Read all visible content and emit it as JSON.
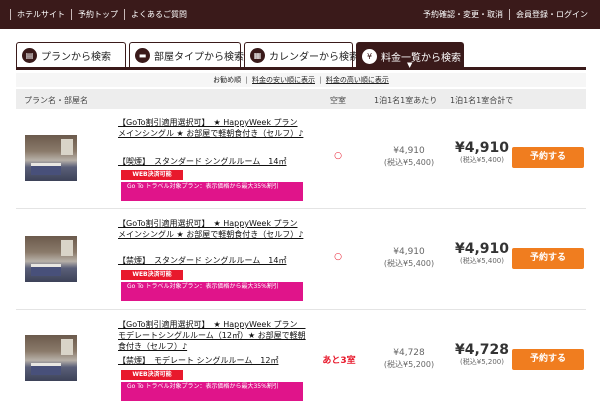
{
  "topbar": {
    "left": [
      "ホテルサイト",
      "予約トップ",
      "よくあるご質問"
    ],
    "right": [
      "予約確認・変更・取消",
      "会員登録・ログイン"
    ]
  },
  "tabs": [
    {
      "label": "プランから検索",
      "icon": "plan-icon",
      "active": false
    },
    {
      "label": "部屋タイプから検索",
      "icon": "bed-icon",
      "active": false
    },
    {
      "label": "カレンダーから検索",
      "icon": "calendar-icon",
      "active": false
    },
    {
      "label": "料金一覧から検索",
      "icon": "yen-icon",
      "active": true
    }
  ],
  "sort": {
    "items": [
      "お勧め順",
      "料金の安い順に表示",
      "料金の高い順に表示"
    ],
    "separator": "|"
  },
  "table_header": {
    "plan": "プラン名・部屋名",
    "vacancy": "空室",
    "per_person": "1泊1名1室あたり",
    "total": "1泊1名1室合計で"
  },
  "rows": [
    {
      "plan_name": "【GoTo割引適用選択可】　★ HappyWeek プラン メインシングル ★ お部屋で軽朝食付き（セルフ）♪",
      "room": "【喫煙】　スタンダード シングルルーム　14㎡",
      "web_badge": "WEB決済可能",
      "goto_badge": "Go To トラベル対象プラン：表示価格から最大35%割引",
      "vacancy": "○",
      "price_per": "¥4,910",
      "price_per_tax": "(税込¥5,400)",
      "price_total": "¥4,910",
      "price_total_tax": "(税込¥5,400)",
      "book": "予約する"
    },
    {
      "plan_name": "【GoTo割引適用選択可】　★ HappyWeek プラン メインシングル ★ お部屋で軽朝食付き（セルフ）♪",
      "room": "【禁煙】　スタンダード シングルルーム　14㎡",
      "web_badge": "WEB決済可能",
      "goto_badge": "Go To トラベル対象プラン：表示価格から最大35%割引",
      "vacancy": "○",
      "price_per": "¥4,910",
      "price_per_tax": "(税込¥5,400)",
      "price_total": "¥4,910",
      "price_total_tax": "(税込¥5,400)",
      "book": "予約する"
    },
    {
      "plan_name": "【GoTo割引適用選択可】　★ HappyWeek プラン　モデレートシングルルーム（12㎡）★ お部屋で軽朝食付き（セルフ）♪",
      "room": "【禁煙】　モデレート シングルルーム　12㎡",
      "web_badge": "WEB決済可能",
      "goto_badge": "Go To トラベル対象プラン：表示価格から最大35%割引",
      "vacancy": "あと3室",
      "price_per": "¥4,728",
      "price_per_tax": "(税込¥5,200)",
      "price_total": "¥4,728",
      "price_total_tax": "(税込¥5,200)",
      "book": "予約する"
    }
  ],
  "colors": {
    "header": "#3a1a1a",
    "book": "#f07d1f",
    "web": "#e8192c",
    "goto": "#e0148a"
  }
}
